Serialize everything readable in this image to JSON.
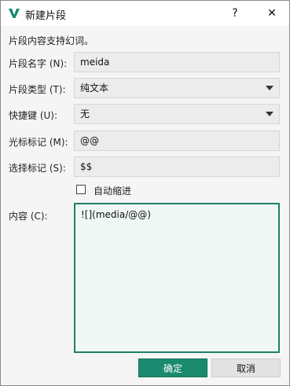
{
  "window": {
    "title": "新建片段",
    "help_symbol": "?",
    "close_symbol": "✕",
    "logo_icon": "vnote-logo",
    "accent_color": "#1a8a6e"
  },
  "form": {
    "description": "片段内容支持幻词。",
    "name": {
      "label": "片段名字 (N):",
      "value": "meida"
    },
    "type": {
      "label": "片段类型 (T):",
      "selected": "纯文本"
    },
    "shortcut": {
      "label": "快捷键 (U):",
      "selected": "无"
    },
    "cursor_mark": {
      "label": "光标标记 (M):",
      "value": "@@"
    },
    "selection_mark": {
      "label": "选择标记 (S):",
      "value": "$$"
    },
    "auto_indent": {
      "label": "自动缩进",
      "checked": false
    },
    "content": {
      "label": "内容 (C):",
      "value": "![](media/@@)"
    }
  },
  "buttons": {
    "ok": "确定",
    "cancel": "取消"
  }
}
